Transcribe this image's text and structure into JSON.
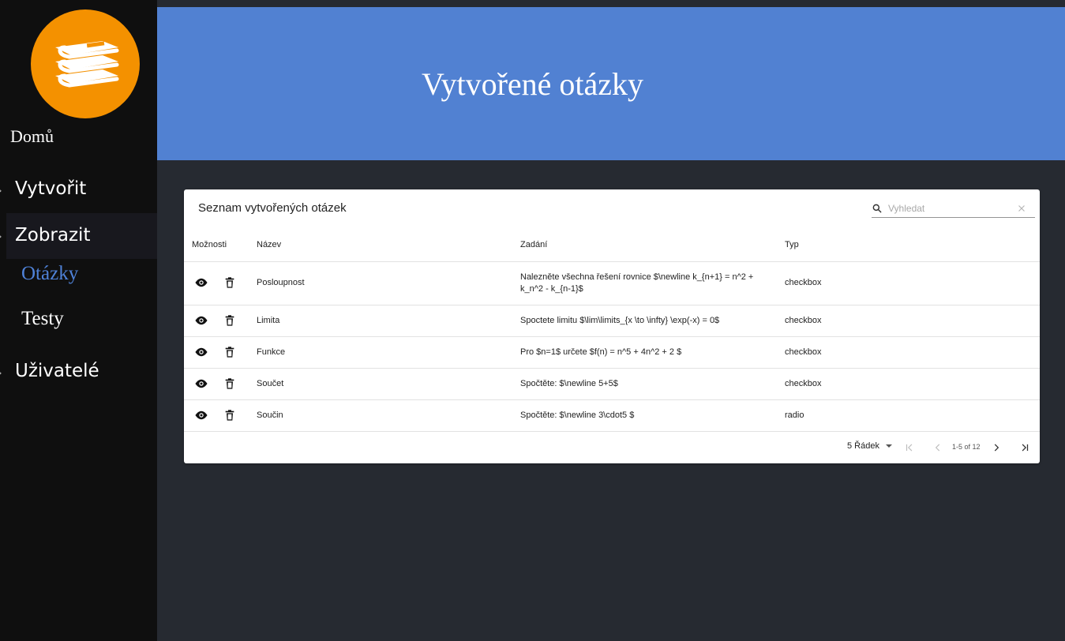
{
  "sidebar": {
    "home": "Domů",
    "create": "Vytvořit",
    "show": "Zobrazit",
    "questions": "Otázky",
    "tests": "Testy",
    "users": "Uživatelé",
    "caret": "›"
  },
  "header": {
    "title": "Vytvořené otázky"
  },
  "card": {
    "title": "Seznam vytvořených otázek",
    "search_placeholder": "Vyhledat",
    "columns": {
      "options": "Možnosti",
      "name": "Název",
      "task": "Zadání",
      "type": "Typ"
    },
    "rows": [
      {
        "name": "Posloupnost",
        "task": "Nalezněte všechna řešení rovnice $\\newline k_{n+1} = n^2 + k_n^2 - k_{n-1}$",
        "type": "checkbox"
      },
      {
        "name": "Limita",
        "task": "Spoctete limitu $\\lim\\limits_{x \\to \\infty} \\exp(-x) = 0$",
        "type": "checkbox"
      },
      {
        "name": "Funkce",
        "task": "Pro $n=1$ určete $f(n) = n^5 + 4n^2 + 2 $",
        "type": "checkbox"
      },
      {
        "name": "Součet",
        "task": "Spočtěte: $\\newline 5+5$",
        "type": "checkbox"
      },
      {
        "name": "Součin",
        "task": "Spočtěte: $\\newline 3\\cdot5 $",
        "type": "radio"
      }
    ],
    "footer": {
      "rows_per_page": "5 Řádek",
      "range": "1-5 of 12"
    }
  },
  "colors": {
    "header": "#5181d2",
    "logo": "#f49100",
    "active_sub": "#4f82d8",
    "sidebar": "#0f0f0f",
    "background": "#262a31"
  },
  "icons": [
    "books-icon",
    "search-icon",
    "clear-icon",
    "eye-icon",
    "trash-icon",
    "first-page-icon",
    "prev-page-icon",
    "next-page-icon",
    "last-page-icon"
  ]
}
